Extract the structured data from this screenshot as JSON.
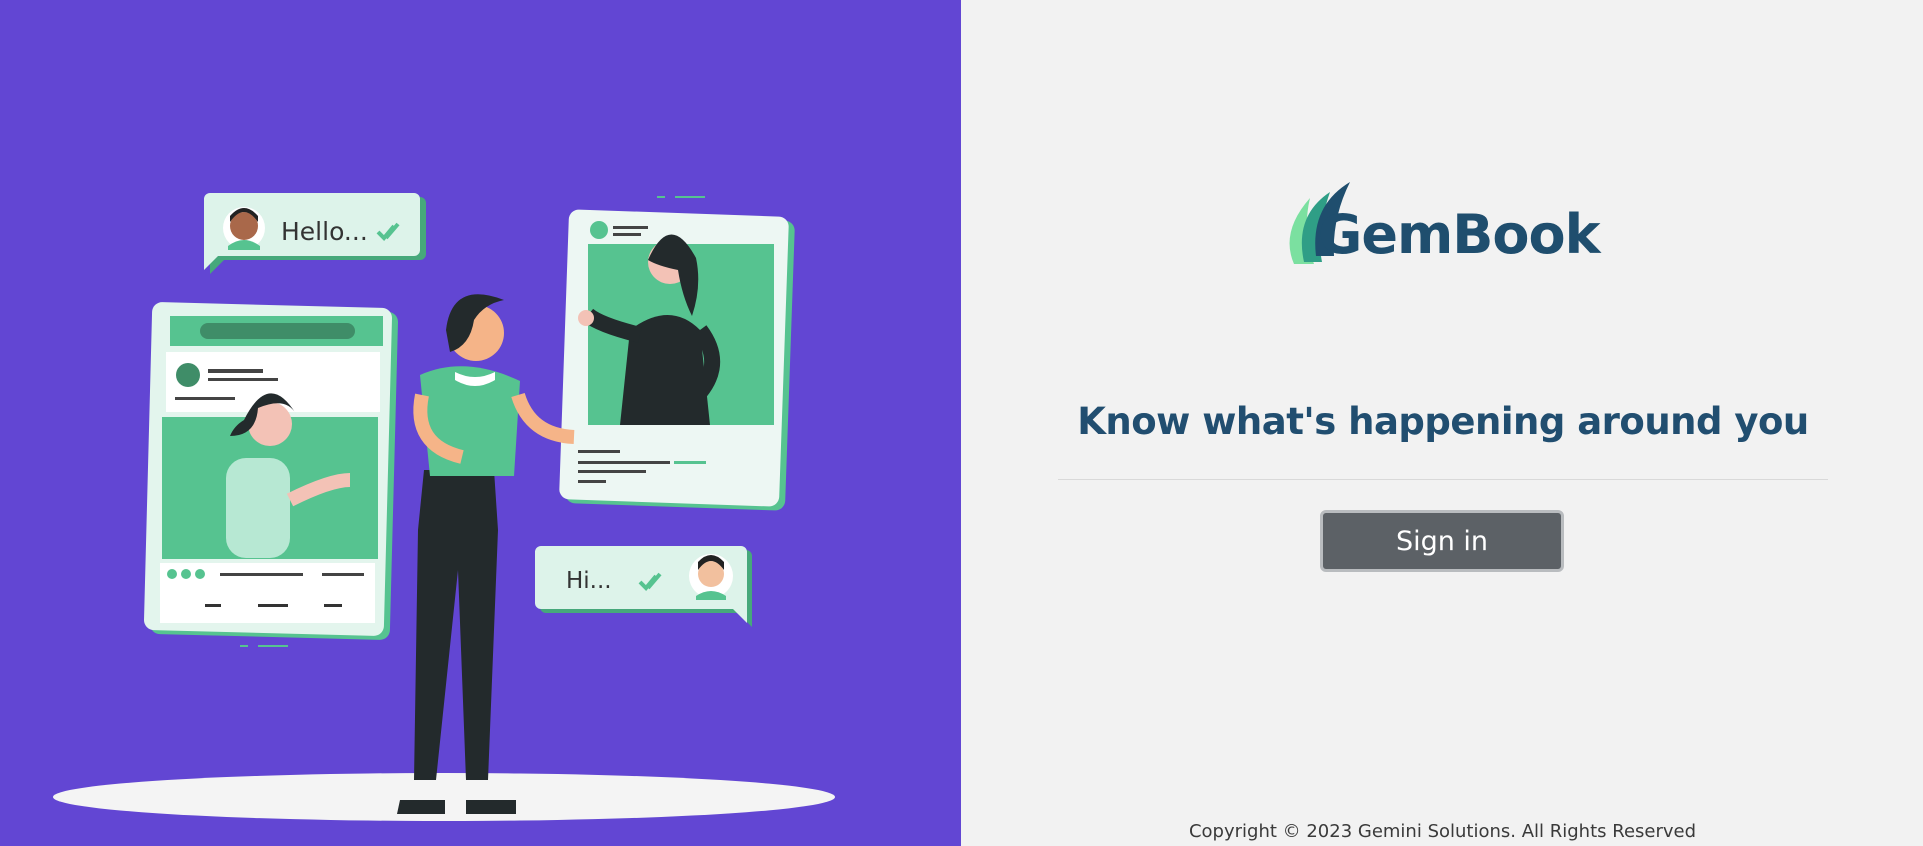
{
  "brand": {
    "name": "GemBook"
  },
  "hero": {
    "tagline": "Know what's happening around you"
  },
  "actions": {
    "sign_in_label": "Sign in"
  },
  "footer": {
    "copyright": "Copyright © 2023 Gemini Solutions. All Rights Reserved"
  },
  "illustration": {
    "bubble_hello": "Hello...",
    "bubble_hi": "Hi..."
  },
  "colors": {
    "left_panel_bg": "#6246d3",
    "right_panel_bg": "#f2f2f2",
    "brand_text": "#1f4e6e",
    "button_bg": "#5c6166",
    "accent_green": "#56c390"
  }
}
